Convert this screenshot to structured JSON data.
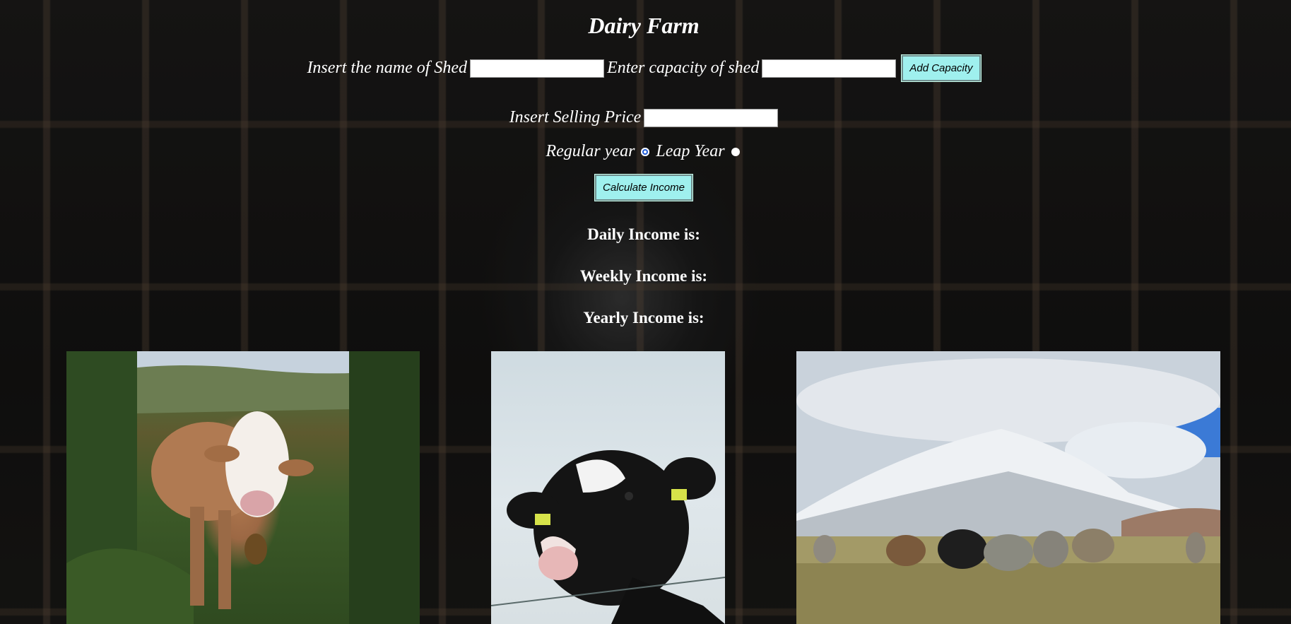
{
  "page": {
    "title": "Dairy Farm"
  },
  "form": {
    "shed_name_label": "Insert the name of Shed",
    "shed_name_value": "",
    "capacity_label": "Enter capacity of shed",
    "capacity_value": "",
    "add_capacity_button": "Add Capacity",
    "selling_price_label": "Insert Selling Price",
    "selling_price_value": "",
    "year_options": [
      {
        "label": "Regular year",
        "checked": true
      },
      {
        "label": "Leap Year",
        "checked": false
      }
    ],
    "calculate_button": "Calculate Income"
  },
  "results": {
    "daily_label": "Daily Income is:",
    "weekly_label": "Weekly Income is:",
    "yearly_label": "Yearly Income is:"
  },
  "images": [
    {
      "name": "brown-cow-photo"
    },
    {
      "name": "holstein-cow-photo"
    },
    {
      "name": "herd-mountain-photo"
    }
  ],
  "colors": {
    "button_bg": "#9ff0ee",
    "text": "#ffffff",
    "radio_accent": "#1f5bd8"
  }
}
